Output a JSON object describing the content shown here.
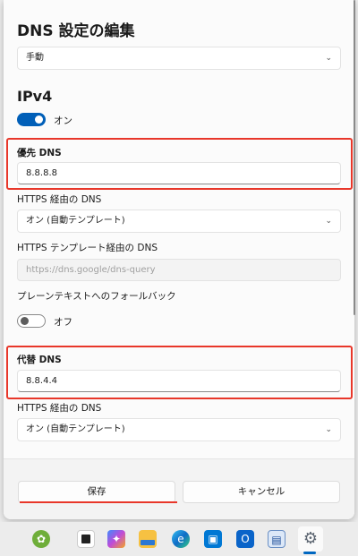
{
  "dialog": {
    "title": "DNS 設定の編集",
    "mode_select": {
      "value": "手動",
      "chevron": "chevron-down-icon"
    }
  },
  "ipv4": {
    "heading": "IPv4",
    "toggle_label": "オン",
    "toggle_on": true,
    "preferred": {
      "label": "優先 DNS",
      "value": "8.8.8.8",
      "https_label": "HTTPS 経由の DNS",
      "https_value": "オン (自動テンプレート)",
      "template_label": "HTTPS テンプレート経由の DNS",
      "template_placeholder": "https://dns.google/dns-query",
      "fallback_label": "プレーンテキストへのフォールバック",
      "fallback_toggle_label": "オフ",
      "fallback_on": false
    },
    "alternate": {
      "label": "代替 DNS",
      "value": "8.8.4.4",
      "https_label": "HTTPS 経由の DNS",
      "https_value": "オン (自動テンプレート)"
    }
  },
  "footer": {
    "save_label": "保存",
    "cancel_label": "キャンセル"
  },
  "taskbar": {
    "icons": [
      "parrot-icon",
      "terminal-icon",
      "copilot-icon",
      "file-explorer-icon",
      "edge-icon",
      "store-icon",
      "outlook-icon",
      "remote-desktop-icon",
      "settings-icon"
    ]
  },
  "colors": {
    "accent": "#005fb8",
    "highlight": "#e8372a"
  }
}
